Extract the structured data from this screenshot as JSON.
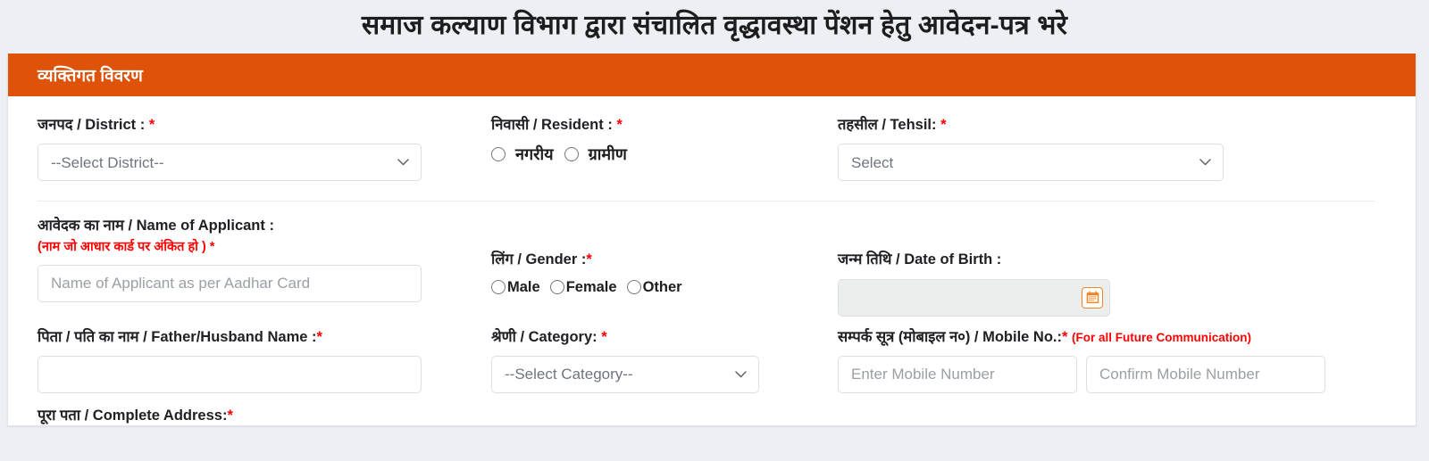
{
  "page": {
    "title": "समाज कल्याण विभाग द्वारा संचालित वृद्धावस्था पेंशन हेतु आवेदन-पत्र भरे",
    "accent_color": "#de520a",
    "background_color": "#eceff3",
    "required_marker": "*"
  },
  "section": {
    "header_title": "व्यक्तिगत विवरण"
  },
  "fields": {
    "district": {
      "label": "जनपद / District : ",
      "required": "*",
      "selected_option": "--Select District--"
    },
    "resident": {
      "label": "निवासी / Resident : ",
      "required": "*",
      "options": [
        {
          "label": "नगरीय"
        },
        {
          "label": "ग्रामीण"
        }
      ]
    },
    "tehsil": {
      "label": "तहसील / Tehsil: ",
      "required": "*",
      "selected_option": "Select"
    },
    "applicant_name": {
      "label": "आवेदक का नाम / Name of Applicant :",
      "sublabel": "(नाम जो आधार कार्ड पर अंकित हो ) *",
      "placeholder": "Name of Applicant as per Aadhar Card",
      "value": ""
    },
    "gender": {
      "label": "लिंग / Gender :",
      "required": "*",
      "options": [
        {
          "label": "Male"
        },
        {
          "label": "Female"
        },
        {
          "label": "Other"
        }
      ]
    },
    "date_of_birth": {
      "label": "जन्म तिथि / Date of Birth :",
      "value": "",
      "calendar_icon": "calendar-icon"
    },
    "father_husband_name": {
      "label": "पिता / पति का नाम / Father/Husband Name :",
      "required": "*",
      "value": ""
    },
    "category": {
      "label": "श्रेणी / Category: ",
      "required": "*",
      "selected_option": "--Select Category--"
    },
    "mobile": {
      "label": "सम्पर्क सूत्र (मोबाइल न०) / Mobile No.:",
      "required": "*",
      "note": "(For all Future Communication)",
      "enter_placeholder": "Enter Mobile Number",
      "confirm_placeholder": "Confirm Mobile Number",
      "enter_value": "",
      "confirm_value": ""
    },
    "complete_address": {
      "label": "पूरा पता / Complete Address:",
      "required": "*"
    }
  }
}
